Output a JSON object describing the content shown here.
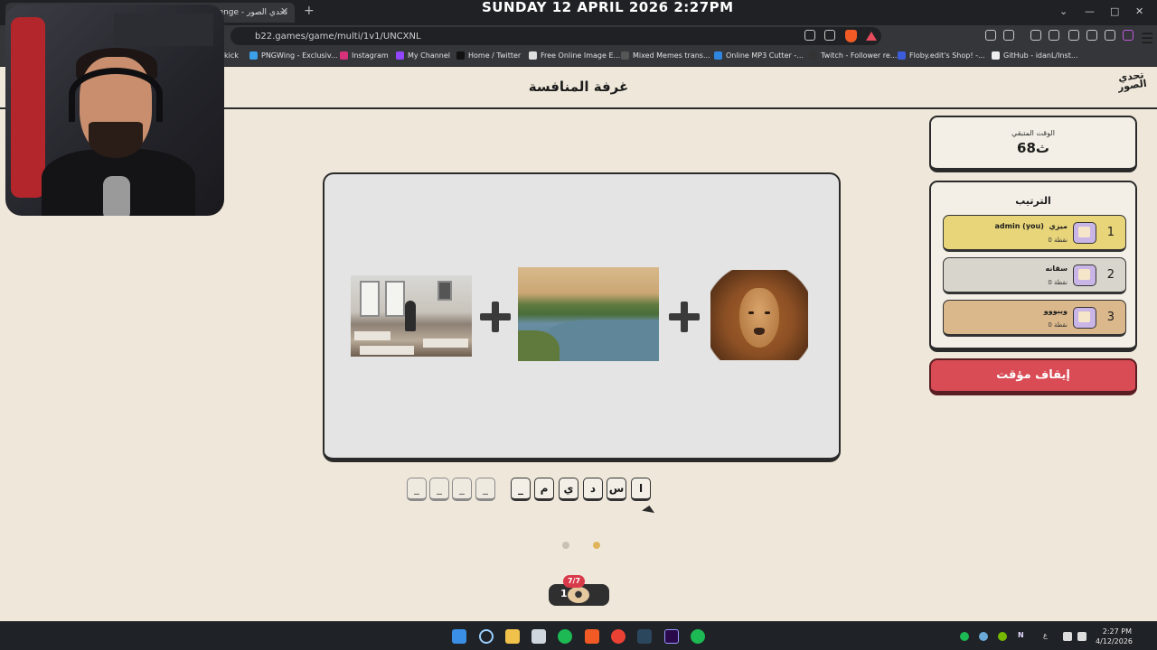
{
  "overlay": {
    "datetime": "SUNDAY 12 APRIL 2026 2:27PM"
  },
  "browser": {
    "tab_title": "Challenge - تحدي الصور",
    "url": "b22.games/game/multi/1v1/UNCXNL",
    "bookmarks": [
      {
        "label": "kick",
        "icon": "kick-icon",
        "color": "#53fc18"
      },
      {
        "label": "PNGWing - Exclusiv...",
        "icon": "pngwing-icon",
        "color": "#3aa0e8"
      },
      {
        "label": "Instagram",
        "icon": "instagram-icon",
        "color": "#d6317a"
      },
      {
        "label": "My Channel",
        "icon": "twitch-icon",
        "color": "#9146ff"
      },
      {
        "label": "Home / Twitter",
        "icon": "x-icon",
        "color": "#111111"
      },
      {
        "label": "Free Online Image E...",
        "icon": "image-editor-icon",
        "color": "#dddddd"
      },
      {
        "label": "Mixed Memes trans...",
        "icon": "memes-icon",
        "color": "#555555"
      },
      {
        "label": "Online MP3 Cutter -...",
        "icon": "mp3-cutter-icon",
        "color": "#2e86de"
      },
      {
        "label": "Twitch - Follower re...",
        "icon": "twitch-icon",
        "color": "#333333"
      },
      {
        "label": "Floby.edit's Shop! -...",
        "icon": "shop-icon",
        "color": "#3b5cdb"
      },
      {
        "label": "GitHub - idanL/Inst...",
        "icon": "github-icon",
        "color": "#eeeeee"
      }
    ]
  },
  "page": {
    "title": "غرفة المنافسة",
    "logo_text": "تحدي الصور"
  },
  "puzzle": {
    "images": [
      {
        "name": "office-image",
        "description_icon": "cluttered-office-image"
      },
      {
        "name": "river-image",
        "description_icon": "nile-river-image"
      },
      {
        "name": "lion-image",
        "description_icon": "lion-image"
      }
    ],
    "answer_word1": [
      "",
      "",
      "",
      ""
    ],
    "answer_word2": [
      "ا",
      "س",
      "د",
      "ي",
      "م",
      "_"
    ],
    "empty_char": "_",
    "dots": [
      {
        "state": "inactive",
        "color": "#c9c2b4"
      },
      {
        "state": "active",
        "color": "#e0b45a"
      }
    ]
  },
  "hint": {
    "count": "1",
    "badge": "7/7"
  },
  "timer": {
    "label": "الوقت المتبقي",
    "value": "68ث"
  },
  "ranking": {
    "title": "الترتيب",
    "players": [
      {
        "rank": "1",
        "name": "ميزي",
        "tag": "admin (you)",
        "points": "0 نقطة",
        "color": "#e8d57a"
      },
      {
        "rank": "2",
        "name": "سقانه",
        "tag": "",
        "points": "0 نقطة",
        "color": "#d8d6cc"
      },
      {
        "rank": "3",
        "name": "ويبووو",
        "tag": "",
        "points": "0 نقطة",
        "color": "#dbb88c"
      }
    ]
  },
  "pause_button": "إيقاف مؤقت",
  "taskbar": {
    "time": "2:27 PM",
    "date": "4/12/2026",
    "lang": "ع",
    "tray_n": "N"
  }
}
